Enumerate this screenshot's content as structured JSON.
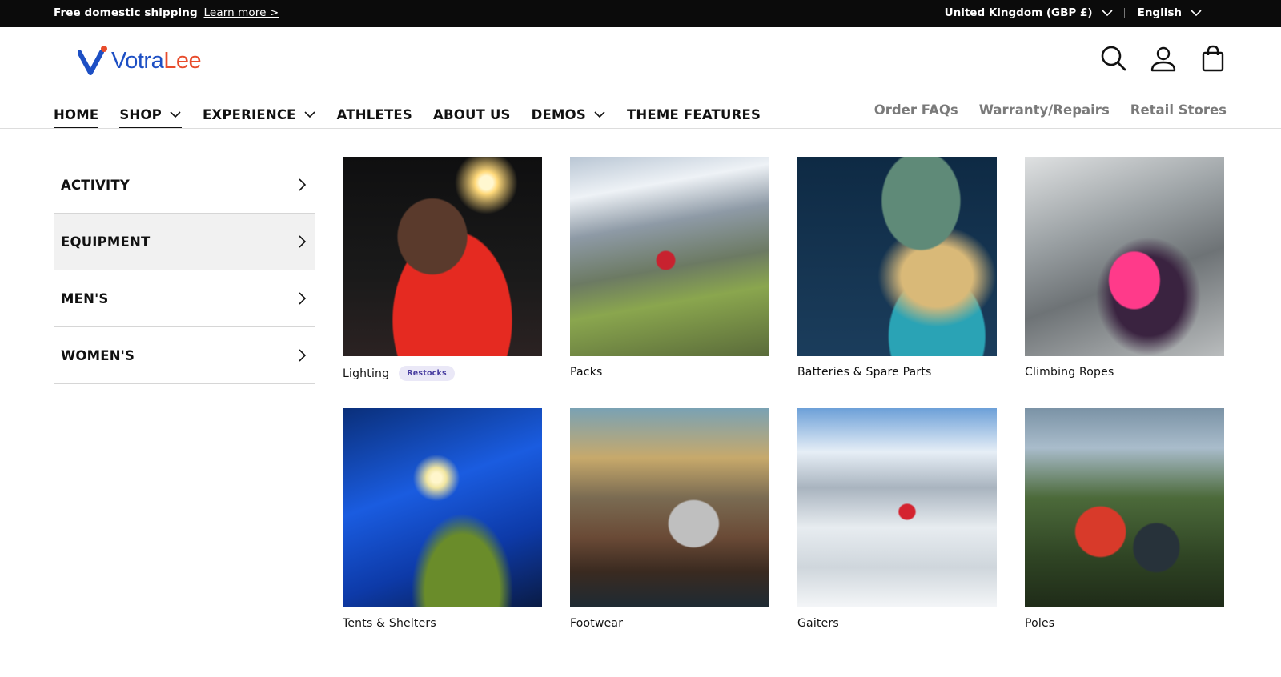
{
  "announcement": {
    "text": "Free domestic shipping",
    "link": "Learn more >",
    "country": "United Kingdom (GBP £)",
    "language": "English"
  },
  "brand": {
    "name_part1": "Votra",
    "name_part2": "Lee",
    "colors": {
      "blue": "#1d4fc4",
      "orange": "#e84c2c"
    }
  },
  "header_icons": [
    "search-icon",
    "account-icon",
    "cart-icon"
  ],
  "nav": {
    "items": [
      {
        "label": "HOME"
      },
      {
        "label": "SHOP"
      },
      {
        "label": "EXPERIENCE"
      },
      {
        "label": "ATHLETES"
      },
      {
        "label": "ABOUT US"
      },
      {
        "label": "DEMOS"
      },
      {
        "label": "THEME FEATURES"
      }
    ],
    "secondary": [
      {
        "label": "Order FAQs"
      },
      {
        "label": "Warranty/Repairs"
      },
      {
        "label": "Retail Stores"
      }
    ]
  },
  "mega_menu": {
    "categories": [
      {
        "label": "ACTIVITY"
      },
      {
        "label": "EQUIPMENT"
      },
      {
        "label": "MEN'S"
      },
      {
        "label": "WOMEN'S"
      }
    ],
    "products": [
      {
        "label": "Lighting",
        "badge": "Restocks"
      },
      {
        "label": "Packs"
      },
      {
        "label": "Batteries & Spare Parts"
      },
      {
        "label": "Climbing Ropes"
      },
      {
        "label": "Tents & Shelters"
      },
      {
        "label": "Footwear"
      },
      {
        "label": "Gaiters"
      },
      {
        "label": "Poles"
      }
    ]
  }
}
